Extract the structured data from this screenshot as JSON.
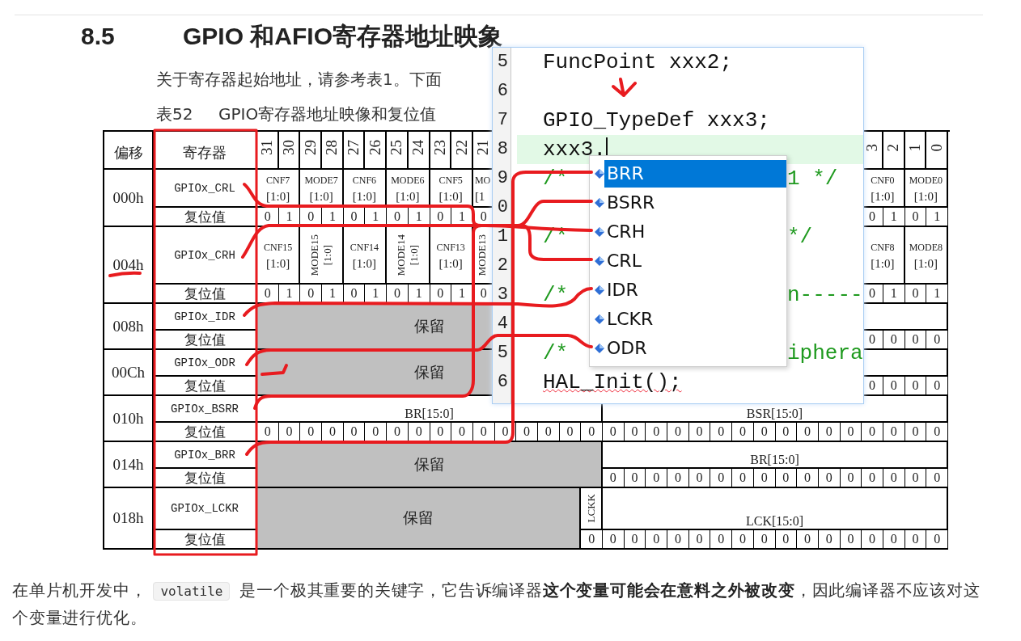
{
  "heading": {
    "number": "8.5",
    "title": "GPIO 和AFIO寄存器地址映象"
  },
  "intro": "关于寄存器起始地址，请参考表1。下面",
  "caption": {
    "number": "表52",
    "title": "GPIO寄存器地址映像和复位值"
  },
  "table": {
    "columns": [
      "偏移",
      "寄存器"
    ],
    "bits": [
      "31",
      "30",
      "29",
      "28",
      "27",
      "26",
      "25",
      "24",
      "23",
      "22",
      "21",
      "3",
      "2",
      "1",
      "0"
    ],
    "registers": [
      {
        "offset": "000h",
        "name": "GPIOx_CRL",
        "reset_label": "复位值",
        "fields": [
          {
            "kind": "field",
            "label": "CNF7",
            "sub": "[1:0]"
          },
          {
            "kind": "field",
            "label": "MODE7",
            "sub": "[1:0]"
          },
          {
            "kind": "field",
            "label": "CNF6",
            "sub": "[1:0]"
          },
          {
            "kind": "field",
            "label": "MODE6",
            "sub": "[1:0]"
          },
          {
            "kind": "field",
            "label": "CNF5",
            "sub": "[1:0]"
          },
          {
            "kind": "cut",
            "label": "MO",
            "sub": "[1"
          },
          {
            "kind": "field",
            "label": "CNF0",
            "sub": "[1:0]"
          },
          {
            "kind": "field",
            "label": "MODE0",
            "sub": "[1:0]"
          }
        ],
        "reset": [
          "0",
          "1",
          "0",
          "1",
          "0",
          "1",
          "0",
          "1",
          "0",
          "1",
          "0",
          "0",
          "1",
          "0",
          "1"
        ]
      },
      {
        "offset": "004h",
        "name": "GPIOx_CRH",
        "reset_label": "复位值",
        "fields": [
          {
            "kind": "field",
            "label": "CNF15",
            "sub": "[1:0]"
          },
          {
            "kind": "vertical",
            "label": "MODE15",
            "sub": "[1:0]"
          },
          {
            "kind": "field",
            "label": "CNF14",
            "sub": "[1:0]"
          },
          {
            "kind": "vertical",
            "label": "MODE14",
            "sub": "[1:0]"
          },
          {
            "kind": "field",
            "label": "CNF13",
            "sub": "[1:0]"
          },
          {
            "kind": "vertical-cut",
            "label": "MODE13"
          },
          {
            "kind": "field",
            "label": "CNF8",
            "sub": "[1:0]"
          },
          {
            "kind": "field",
            "label": "MODE8",
            "sub": "[1:0]"
          }
        ],
        "reset": [
          "0",
          "1",
          "0",
          "1",
          "0",
          "1",
          "0",
          "1",
          "0",
          "1",
          "0",
          "0",
          "1",
          "0",
          "1"
        ]
      },
      {
        "offset": "008h",
        "name": "GPIOx_IDR",
        "reset_label": "复位值",
        "fields": [
          {
            "kind": "reserved",
            "label": "保留"
          }
        ],
        "reset": [
          "0",
          "0",
          "0",
          "0"
        ]
      },
      {
        "offset": "00Ch",
        "name": "GPIOx_ODR",
        "reset_label": "复位值",
        "fields": [
          {
            "kind": "reserved",
            "label": "保留"
          }
        ],
        "reset": [
          "0",
          "0",
          "0",
          "0"
        ]
      },
      {
        "offset": "010h",
        "name": "GPIOx_BSRR",
        "reset_label": "复位值",
        "fields": [
          {
            "kind": "single",
            "label": "BR[15:0]"
          },
          {
            "kind": "single",
            "label": "BSR[15:0]"
          }
        ],
        "reset": [
          "0",
          "0",
          "0",
          "0",
          "0",
          "0",
          "0",
          "0",
          "0",
          "0",
          "0",
          "0",
          "0",
          "0",
          "0",
          "0",
          "0",
          "0",
          "0",
          "0",
          "0",
          "0",
          "0",
          "0",
          "0",
          "0",
          "0",
          "0",
          "0",
          "0",
          "0",
          "0"
        ]
      },
      {
        "offset": "014h",
        "name": "GPIOx_BRR",
        "reset_label": "复位值",
        "fields": [
          {
            "kind": "reserved",
            "label": "保留"
          },
          {
            "kind": "single",
            "label": "BR[15:0]"
          }
        ],
        "reset": [
          "0",
          "0",
          "0",
          "0",
          "0",
          "0",
          "0",
          "0",
          "0",
          "0",
          "0",
          "0",
          "0",
          "0",
          "0",
          "0"
        ]
      },
      {
        "offset": "018h",
        "name": "GPIOx_LCKR",
        "reset_label": "复位值",
        "fields": [
          {
            "kind": "reserved",
            "label": "保留"
          },
          {
            "kind": "vlabel",
            "label": "LCKK"
          },
          {
            "kind": "single",
            "label": "LCK[15:0]"
          }
        ],
        "reset": [
          "0",
          "0",
          "0",
          "0",
          "0",
          "0",
          "0",
          "0",
          "0",
          "0",
          "0",
          "0",
          "0",
          "0",
          "0",
          "0",
          "0"
        ]
      }
    ]
  },
  "editor": {
    "line_numbers": [
      "5",
      "6",
      "7",
      "8",
      "9",
      "0",
      "1",
      "2",
      "3",
      "4",
      "5",
      "6"
    ],
    "lines": [
      {
        "kind": "code",
        "text": "FuncPoint xxx2;",
        "current": false,
        "error": false
      },
      {
        "kind": "blank",
        "current": false
      },
      {
        "kind": "code",
        "text": "GPIO_TypeDef xxx3;",
        "current": false,
        "error": false
      },
      {
        "kind": "code",
        "text": "xxx3.",
        "current": true,
        "error": false
      },
      {
        "kind": "comment",
        "text": "/*",
        "tail": "1 */",
        "current": false,
        "error": false
      },
      {
        "kind": "blank",
        "current": false
      },
      {
        "kind": "comment",
        "text": "/*",
        "tail": "*/",
        "current": false,
        "error": false
      },
      {
        "kind": "blank",
        "current": false
      },
      {
        "kind": "comment",
        "text": "/*",
        "tail": "n-----",
        "current": false,
        "error": false
      },
      {
        "kind": "blank",
        "current": false
      },
      {
        "kind": "comment",
        "text": "/*",
        "tail": "iphera",
        "current": false,
        "error": false
      },
      {
        "kind": "code",
        "text": "HAL_Init();",
        "current": false,
        "error": true
      }
    ],
    "completion": [
      {
        "label": "BRR",
        "selected": true
      },
      {
        "label": "BSRR",
        "selected": false
      },
      {
        "label": "CRH",
        "selected": false
      },
      {
        "label": "CRL",
        "selected": false
      },
      {
        "label": "IDR",
        "selected": false
      },
      {
        "label": "LCKR",
        "selected": false
      },
      {
        "label": "ODR",
        "selected": false
      }
    ]
  },
  "body_text": {
    "before": "在单片机开发中，",
    "code": "volatile",
    "after": "是一个极其重要的关键字，它告诉编译器**这个变量可能会在意料之外被改变**，因此编译器不应该对这个变量进行优化。"
  }
}
